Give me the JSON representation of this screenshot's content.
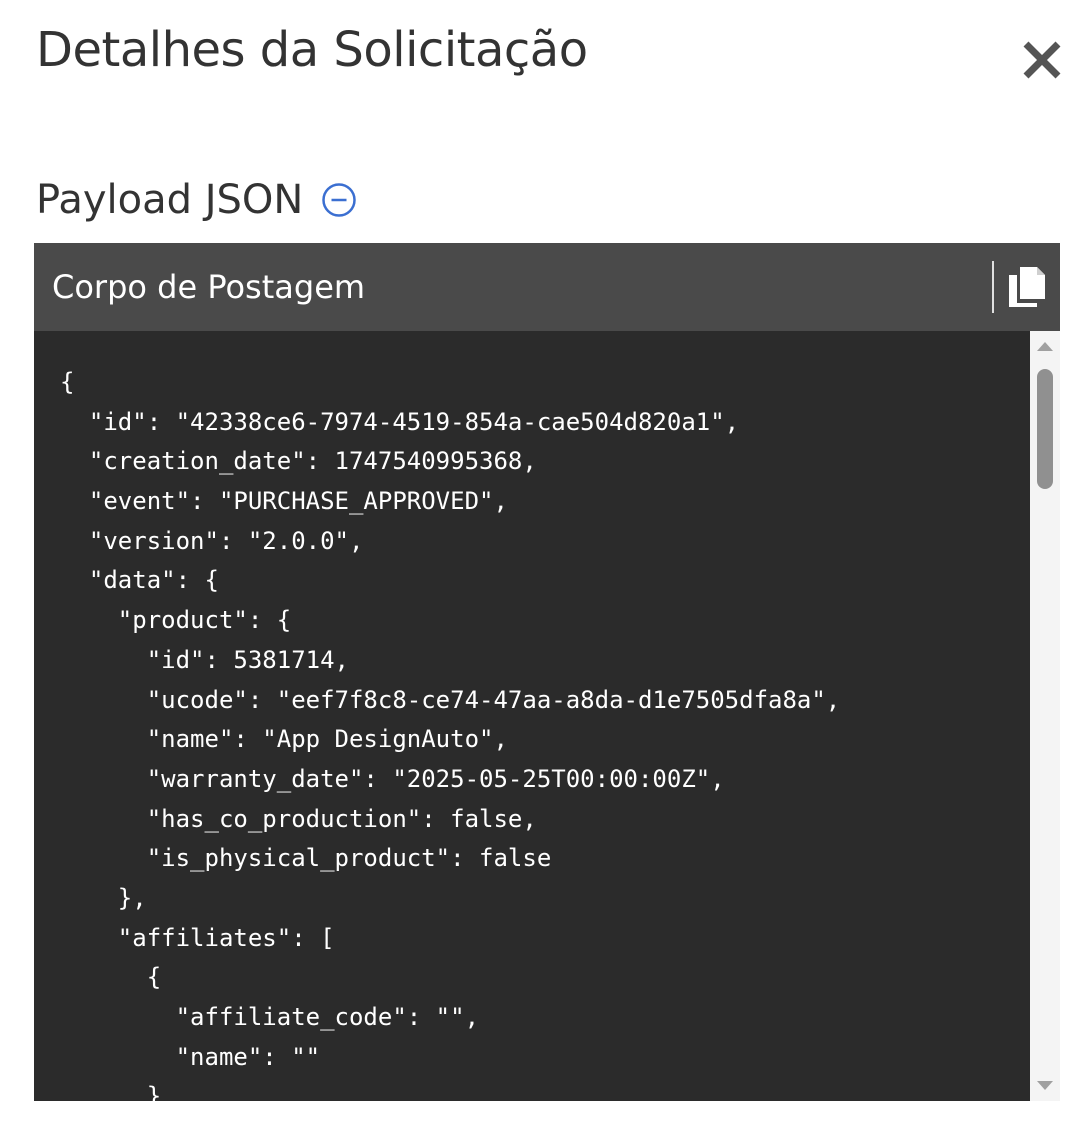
{
  "modal": {
    "title": "Detalhes da Solicitação"
  },
  "section": {
    "heading": "Payload JSON"
  },
  "panel": {
    "header_title": "Corpo de Postagem"
  },
  "code_lines": [
    "{",
    "  \"id\": \"42338ce6-7974-4519-854a-cae504d820a1\",",
    "  \"creation_date\": 1747540995368,",
    "  \"event\": \"PURCHASE_APPROVED\",",
    "  \"version\": \"2.0.0\",",
    "  \"data\": {",
    "    \"product\": {",
    "      \"id\": 5381714,",
    "      \"ucode\": \"eef7f8c8-ce74-47aa-a8da-d1e7505dfa8a\",",
    "      \"name\": \"App DesignAuto\",",
    "      \"warranty_date\": \"2025-05-25T00:00:00Z\",",
    "      \"has_co_production\": false,",
    "      \"is_physical_product\": false",
    "    },",
    "    \"affiliates\": [",
    "      {",
    "        \"affiliate_code\": \"\",",
    "        \"name\": \"\"",
    "      }"
  ],
  "colors": {
    "code_background": "#2b2b2b",
    "code_header": "#4a4a4a",
    "accent_icon": "#3b6fd1",
    "close_icon": "#555555"
  },
  "icons": {
    "close": "close-icon",
    "collapse": "minus-circle-icon",
    "copy": "copy-icon",
    "scroll_up": "caret-up-icon",
    "scroll_down": "caret-down-icon"
  }
}
